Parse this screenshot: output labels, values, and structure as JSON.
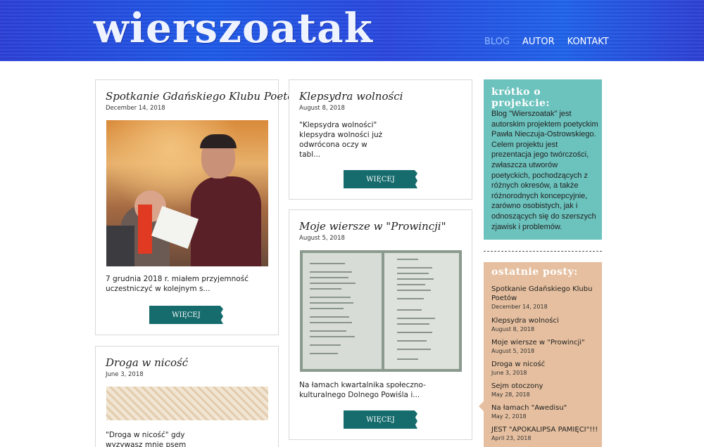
{
  "site": {
    "logo": "wierszoatak",
    "nav": [
      "BLOG",
      "AUTOR",
      "KONTAKT"
    ]
  },
  "posts": [
    {
      "title": "Spotkanie Gdańskiego Klubu Poetów",
      "date": "December 14, 2018",
      "excerpt": "7 grudnia 2018 r. miałem przyjemność uczestniczyć w kolejnym s...",
      "more": "WIĘCEJ"
    },
    {
      "title": "Klepsydra wolności",
      "date": "August 8, 2018",
      "excerpt": "\"Klepsydra wolności\" klepsydra wolności już odwrócona oczy w tabl...",
      "more": "WIĘCEJ"
    },
    {
      "title": "Moje wiersze w \"Prowincji\"",
      "date": "August 5, 2018",
      "excerpt": "Na łamach kwartalnika społeczno-kulturalnego Dolnego Powiśla i...",
      "more": "WIĘCEJ"
    },
    {
      "title": "Droga w nicość",
      "date": "June 3, 2018",
      "excerpt": "\"Droga w nicość\" gdy wyzywasz mnie psem"
    }
  ],
  "sidebar": {
    "about_title": "krótko o projekcie:",
    "about_text": "Blog \"Wierszoatak\" jest autorskim projektem poetyckim Pawła Nieczuja-Ostrowskiego. Celem projektu jest prezentacja jego twórczości, zwłaszcza utworów poetyckich, pochodzących z różnych okresów, a także różnorodnych koncepcyjnie, zarówno osobistych, jak i odnoszących się do szerszych zjawisk i problemów.",
    "recent_title": "ostatnie posty:",
    "recent": [
      {
        "title": "Spotkanie Gdańskiego Klubu Poetów",
        "date": "December 14, 2018"
      },
      {
        "title": "Klepsydra wolności",
        "date": "August 8, 2018"
      },
      {
        "title": "Moje wiersze w \"Prowincji\"",
        "date": "August 5, 2018"
      },
      {
        "title": "Droga w nicość",
        "date": "June 3, 2018"
      },
      {
        "title": "Sejm otoczony",
        "date": "May 28, 2018"
      },
      {
        "title": "Na łamach \"Awedisu\"",
        "date": "May 2, 2018"
      },
      {
        "title": "JEST \"APOKALIPSA PAMIĘCI\"!!!",
        "date": "April 23, 2018"
      }
    ]
  }
}
